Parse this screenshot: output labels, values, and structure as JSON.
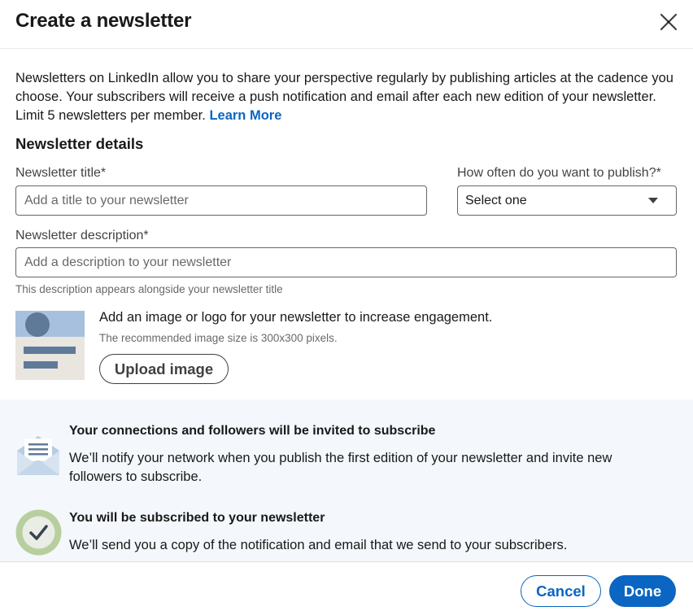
{
  "dialog": {
    "title": "Create a newsletter",
    "close_icon": "close-icon"
  },
  "intro": {
    "text": "Newsletters on LinkedIn allow you to share your perspective regularly by publishing articles at the cadence you choose. Your subscribers will receive a push notification and email after each new edition of your newsletter. Limit 5 newsletters per member.",
    "learn_more": "Learn More"
  },
  "details": {
    "heading": "Newsletter details",
    "title_label": "Newsletter title*",
    "title_placeholder": "Add a title to your newsletter",
    "title_value": "",
    "frequency_label": "How often do you want to publish?*",
    "frequency_value": "Select one",
    "description_label": "Newsletter description*",
    "description_placeholder": "Add a description to your newsletter",
    "description_value": "",
    "description_helper": "This description appears alongside your newsletter title"
  },
  "image": {
    "heading": "Add an image or logo for your newsletter to increase engagement.",
    "subtext": "The recommended image size is 300x300 pixels.",
    "upload_label": "Upload image",
    "icon": "image-placeholder-icon"
  },
  "info": {
    "invite_title": "Your connections and followers will be invited to subscribe",
    "invite_text": "We’ll notify your network when you publish the first edition of your newsletter and invite new followers to subscribe.",
    "invite_icon": "envelope-icon",
    "subscribed_title": "You will be subscribed to your newsletter",
    "subscribed_text": "We’ll send you a copy of the notification and email that we send to your subscribers.",
    "subscribed_icon": "checkmark-icon"
  },
  "footer": {
    "cancel_label": "Cancel",
    "done_label": "Done"
  },
  "colors": {
    "accent": "#0a66c2",
    "panel_bg": "#f4f7fb",
    "thumb_bg": "#e9e5df",
    "thumb_blue": "#a7c0dd",
    "thumb_dark": "#5f7a99",
    "check_ring": "#b7cf9e"
  }
}
